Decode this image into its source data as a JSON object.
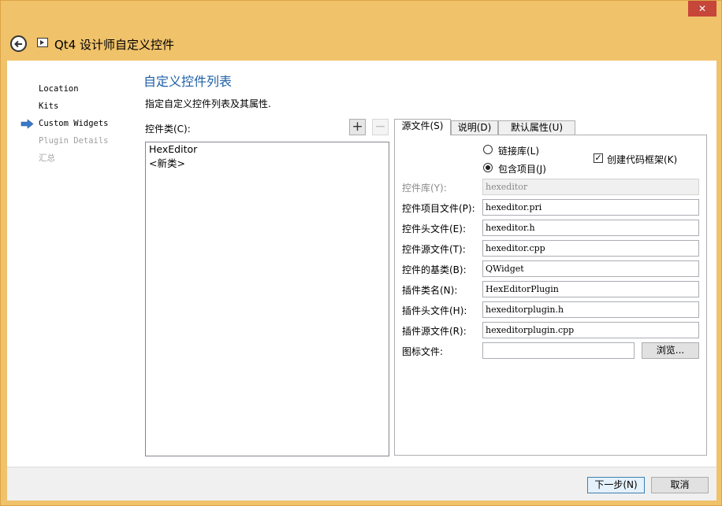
{
  "window": {
    "title": "Qt4 设计师自定义控件",
    "close_glyph": "✕"
  },
  "sidebar": {
    "items": [
      {
        "label": "Location",
        "state": "normal"
      },
      {
        "label": "Kits",
        "state": "normal"
      },
      {
        "label": "Custom Widgets",
        "state": "active"
      },
      {
        "label": "Plugin Details",
        "state": "disabled"
      },
      {
        "label": "汇总",
        "state": "disabled"
      }
    ]
  },
  "page": {
    "title": "自定义控件列表",
    "subtitle": "指定自定义控件列表及其属性."
  },
  "class_list": {
    "label": "控件类(C):",
    "add_glyph": "+",
    "remove_glyph": "−",
    "items": [
      "HexEditor",
      "<新类>"
    ]
  },
  "tabs": [
    {
      "label": "源文件(S)",
      "selected": true
    },
    {
      "label": "说明(D)",
      "selected": false
    },
    {
      "label": "默认属性(U)",
      "selected": false
    }
  ],
  "source_tab": {
    "radio_link_library": {
      "label": "链接库(L)",
      "checked": false
    },
    "radio_include_project": {
      "label": "包含项目(J)",
      "checked": true
    },
    "checkbox_create_skeleton": {
      "label": "创建代码框架(K)",
      "checked": true
    },
    "check_glyph": "✓",
    "fields": [
      {
        "label": "控件库(Y):",
        "value": "hexeditor",
        "readonly": true
      },
      {
        "label": "控件项目文件(P):",
        "value": "hexeditor.pri",
        "readonly": false
      },
      {
        "label": "控件头文件(E):",
        "value": "hexeditor.h",
        "readonly": false
      },
      {
        "label": "控件源文件(T):",
        "value": "hexeditor.cpp",
        "readonly": false
      },
      {
        "label": "控件的基类(B):",
        "value": "QWidget",
        "readonly": false
      },
      {
        "label": "插件类名(N):",
        "value": "HexEditorPlugin",
        "readonly": false
      },
      {
        "label": "插件头文件(H):",
        "value": "hexeditorplugin.h",
        "readonly": false
      },
      {
        "label": "插件源文件(R):",
        "value": "hexeditorplugin.cpp",
        "readonly": false
      }
    ],
    "icon_file": {
      "label": "图标文件:",
      "value": "",
      "browse_label": "浏览..."
    }
  },
  "footer": {
    "next_label": "下一步(N)",
    "cancel_label": "取消"
  },
  "colors": {
    "frame": "#f0c26a",
    "title_blue": "#1e5fa6",
    "close_red": "#c7463a",
    "arrow_blue": "#3a78c9"
  },
  "icons": {
    "back": "back-arrow-icon",
    "app": "app-icon",
    "current_step": "arrow-right-icon"
  }
}
